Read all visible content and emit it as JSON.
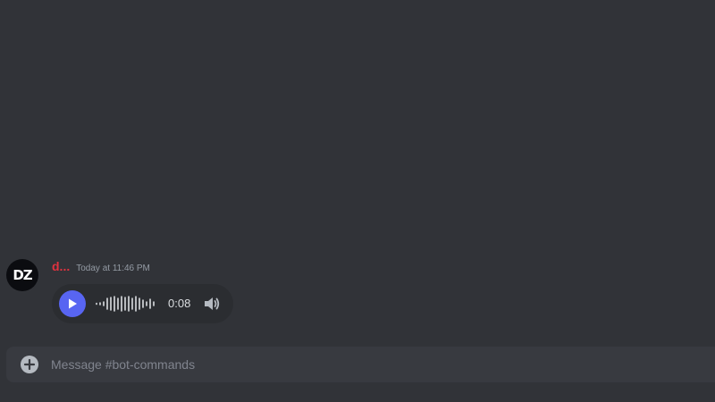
{
  "message": {
    "avatar_initials": "DZ",
    "username": "d...",
    "timestamp": "Today at 11:46 PM",
    "voice": {
      "play_icon": "play-icon",
      "duration": "0:08",
      "volume_icon": "speaker-icon"
    }
  },
  "composer": {
    "add_icon": "plus-circle-icon",
    "placeholder": "Message #bot-commands"
  },
  "colors": {
    "background": "#313338",
    "username": "#e0323f",
    "accent": "#5865f2",
    "composer_bg": "#383a40"
  }
}
